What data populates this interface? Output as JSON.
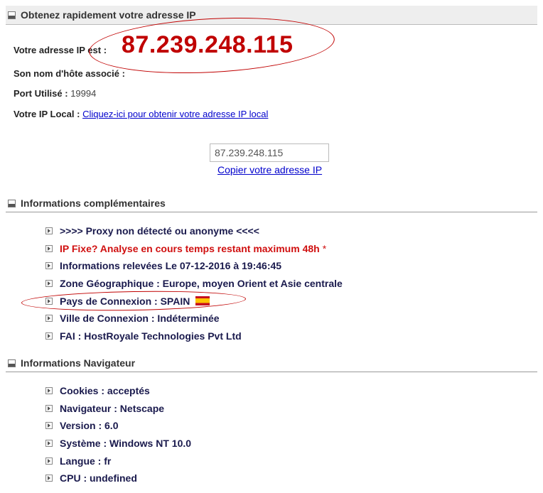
{
  "sections": {
    "main": {
      "title": "Obtenez rapidement votre adresse IP"
    },
    "complementary": {
      "title": "Informations complémentaires"
    },
    "browser": {
      "title": "Informations Navigateur"
    }
  },
  "ip_info": {
    "ip_label": "Votre adresse IP est :",
    "ip_value": "87.239.248.115",
    "hostname_label": "Son nom d'hôte associé :",
    "hostname_value": "",
    "port_label": "Port Utilisé :",
    "port_value": "19994",
    "local_ip_label": "Votre IP Local :",
    "local_ip_link": "Cliquez-ici pour obtenir votre adresse IP local"
  },
  "copy_box": {
    "value": "87.239.248.115",
    "link": "Copier votre adresse IP"
  },
  "complementary_items": [
    {
      "text": "&gt;&gt;&gt;&gt; Proxy non détecté ou anonyme &lt;&lt;&lt;&lt;"
    },
    {
      "text": "IP Fixe? Analyse en cours temps restant maximum 48h",
      "star": "*"
    },
    {
      "text": "Informations relevées Le 07-12-2016 à 19:46:45"
    },
    {
      "text": "Zone Géographique : Europe, moyen Orient et Asie centrale"
    },
    {
      "text": "Pays de Connexion : SPAIN"
    },
    {
      "text": "Ville de Connexion : Indéterminée"
    },
    {
      "text": "FAI : HostRoyale Technologies Pvt Ltd"
    }
  ],
  "browser_items": [
    {
      "text": "Cookies : acceptés"
    },
    {
      "text": "Navigateur : Netscape"
    },
    {
      "text": "Version : 6.0"
    },
    {
      "text": "Système : Windows NT 10.0"
    },
    {
      "text": "Langue : fr"
    },
    {
      "text": "CPU : undefined"
    }
  ],
  "colors": {
    "ip_highlight": "#c00000",
    "annotation_ellipse": "#c00000",
    "link": "#0000cc",
    "warning_text": "#d01010"
  },
  "icons": {
    "section_toggle": "collapse-icon",
    "list_bullet": "arrow-right-icon",
    "country_flag": "spain-flag-icon"
  }
}
